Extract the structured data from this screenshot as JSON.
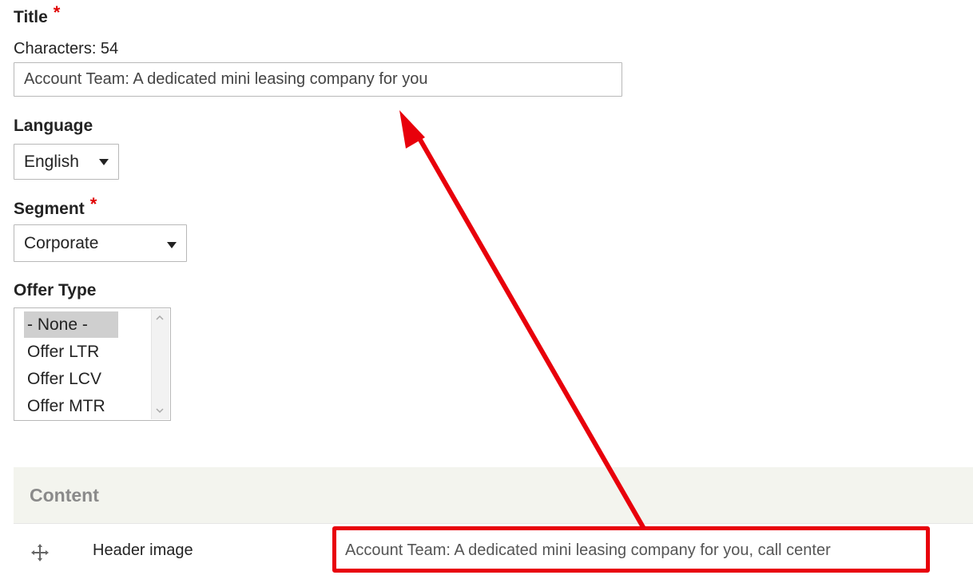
{
  "form": {
    "title_label": "Title",
    "required_mark": "*",
    "char_counter": "Characters: 54",
    "title_value": "Account Team: A dedicated mini leasing company for you",
    "language_label": "Language",
    "language_value": "English",
    "segment_label": "Segment",
    "segment_value": "Corporate",
    "offer_type_label": "Offer Type",
    "offer_type_options": [
      "- None -",
      "Offer LTR",
      "Offer LCV",
      "Offer MTR"
    ],
    "offer_type_selected": "- None -"
  },
  "content_section": {
    "title": "Content",
    "row_label": "Header image",
    "row_value": "Account Team: A dedicated mini leasing company for you, call center"
  },
  "annotation": {
    "color": "#e8000b"
  }
}
